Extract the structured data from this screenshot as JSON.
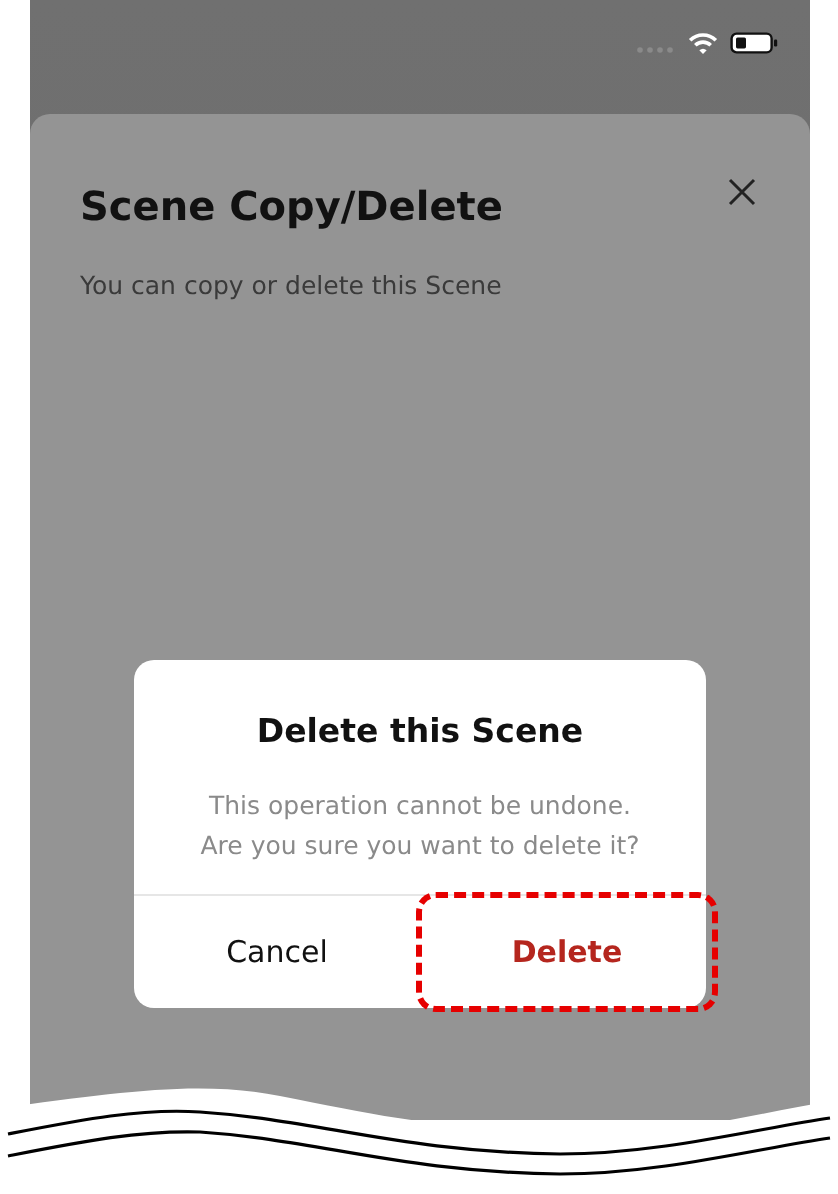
{
  "sheet": {
    "title": "Scene Copy/Delete",
    "subtitle": "You can copy or delete this Scene"
  },
  "dialog": {
    "title": "Delete this Scene",
    "message": "This operation cannot be undone.\nAre you sure you want to delete it?",
    "buttons": [
      {
        "label": "Cancel",
        "kind": "cancel",
        "highlighted": false
      },
      {
        "label": "Delete",
        "kind": "destructive",
        "highlighted": true
      }
    ]
  }
}
